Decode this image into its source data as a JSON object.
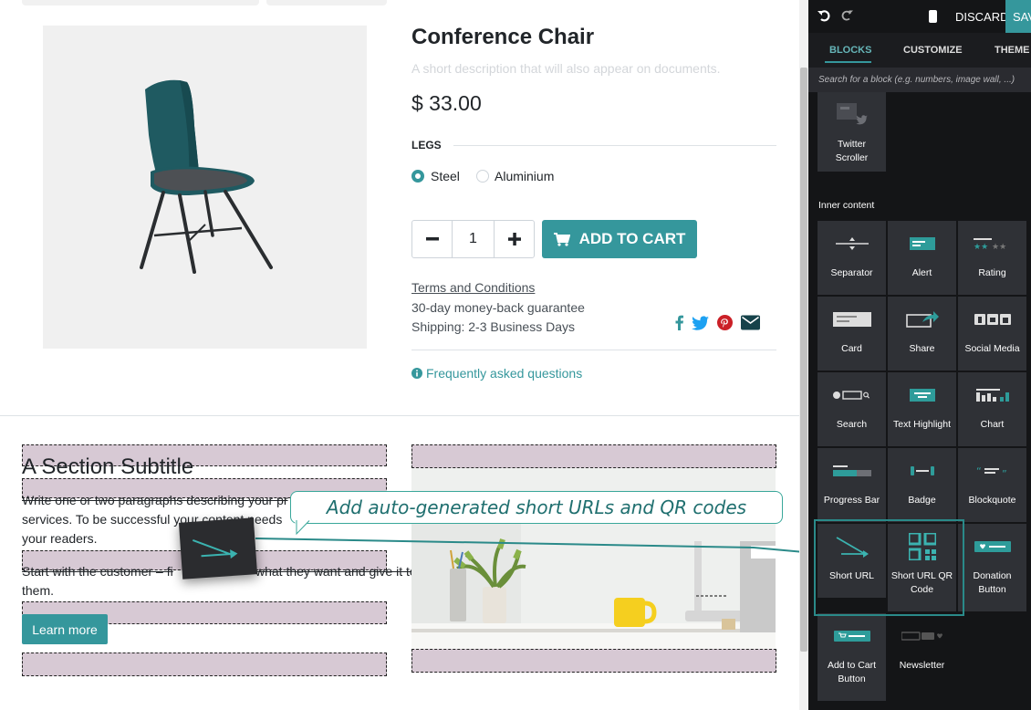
{
  "product": {
    "name": "Conference Chair",
    "description": "A short description that will also appear on documents.",
    "price": "$ 33.00",
    "attribute_name": "LEGS",
    "options": [
      "Steel",
      "Aluminium"
    ],
    "selected_option": "Steel",
    "quantity": "1",
    "add_to_cart": "ADD TO CART",
    "terms": "Terms and Conditions",
    "guarantee": "30-day money-back guarantee",
    "shipping": "Shipping: 2-3 Business Days",
    "faq": "Frequently asked questions"
  },
  "section": {
    "subtitle": "A Section Subtitle",
    "para1_line1": "Write one or two paragraphs describing your pr",
    "para1_line2": "services. To be successful your content needs",
    "para1_line3": "your readers.",
    "para2_line1": "Start with the customer – fi",
    "para2_line1b": "what they want and give it to",
    "para2_line2": "them.",
    "learn_more": "Learn more"
  },
  "tooltip": "Add auto-generated short URLs and QR codes",
  "editor": {
    "discard": "DISCARD",
    "save": "SAV",
    "tabs": [
      "BLOCKS",
      "CUSTOMIZE",
      "THEME"
    ],
    "active_tab": "BLOCKS",
    "search_placeholder": "Search for a block (e.g. numbers, image wall, ...)",
    "top_block": "Twitter Scroller",
    "category": "Inner content",
    "blocks": [
      "Separator",
      "Alert",
      "Rating",
      "Card",
      "Share",
      "Social Media",
      "Search",
      "Text Highlight",
      "Chart",
      "Progress Bar",
      "Badge",
      "Blockquote",
      "Short URL",
      "Short URL QR Code",
      "Donation Button",
      "Add to Cart Button",
      "Newsletter"
    ]
  },
  "colors": {
    "accent": "#35979c",
    "panel_bg": "#141517",
    "tile_bg": "#2f3136",
    "dropzone": "#d7c9d4"
  }
}
